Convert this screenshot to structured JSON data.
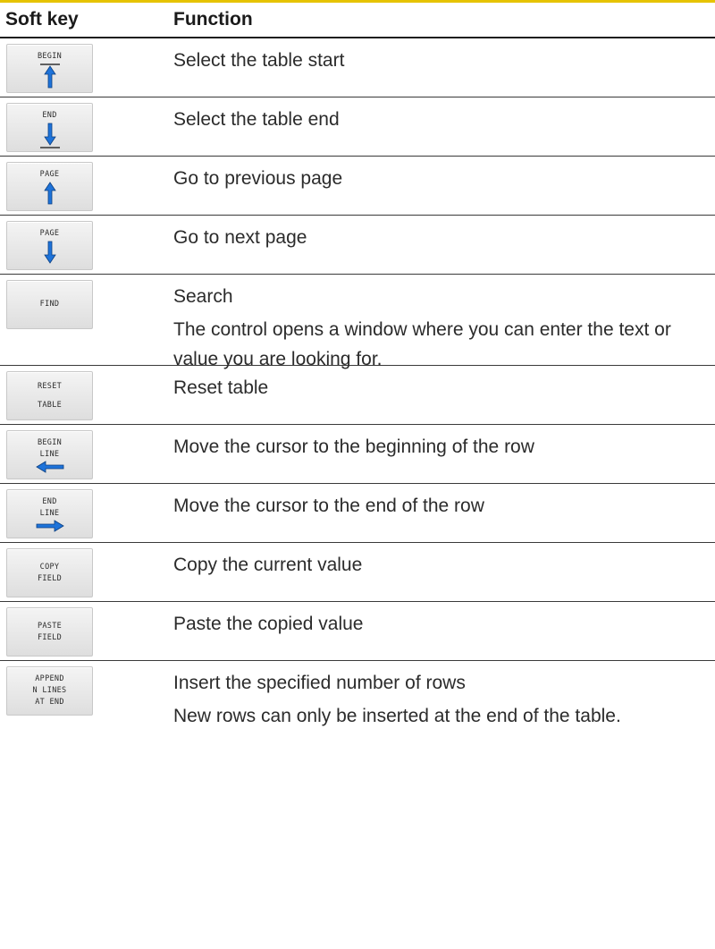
{
  "table": {
    "header": {
      "soft_key": "Soft key",
      "function": "Function"
    },
    "rows": [
      {
        "key_lines": [
          "BEGIN"
        ],
        "icon": "arrow-up-to-bar-icon",
        "function": "Select the table start"
      },
      {
        "key_lines": [
          "END"
        ],
        "icon": "arrow-down-to-bar-icon",
        "function": "Select the table end"
      },
      {
        "key_lines": [
          "PAGE"
        ],
        "icon": "arrow-up-icon",
        "function": "Go to previous page"
      },
      {
        "key_lines": [
          "PAGE"
        ],
        "icon": "arrow-down-icon",
        "function": "Go to next page"
      },
      {
        "key_lines": [
          "FIND"
        ],
        "function": "Search",
        "description": "The control opens a window where you can enter the text or value you are looking for."
      },
      {
        "key_lines": [
          "RESET",
          "TABLE"
        ],
        "function": "Reset table"
      },
      {
        "key_lines": [
          "BEGIN",
          "LINE"
        ],
        "icon": "arrow-left-icon",
        "function": "Move the cursor to the beginning of the row"
      },
      {
        "key_lines": [
          "END",
          "LINE"
        ],
        "icon": "arrow-right-icon",
        "function": "Move the cursor to the end of the row"
      },
      {
        "key_lines": [
          "COPY",
          "FIELD"
        ],
        "function": "Copy the current value"
      },
      {
        "key_lines": [
          "PASTE",
          "FIELD"
        ],
        "function": "Paste the copied value"
      },
      {
        "key_lines": [
          "APPEND",
          "N LINES",
          "AT END"
        ],
        "function": "Insert the specified number of rows",
        "description": "New rows can only be inserted at the end of the table."
      }
    ]
  },
  "colors": {
    "top_rule": "#e6c300",
    "arrow_blue": "#1e73d9",
    "rule": "#3a3a3a"
  }
}
